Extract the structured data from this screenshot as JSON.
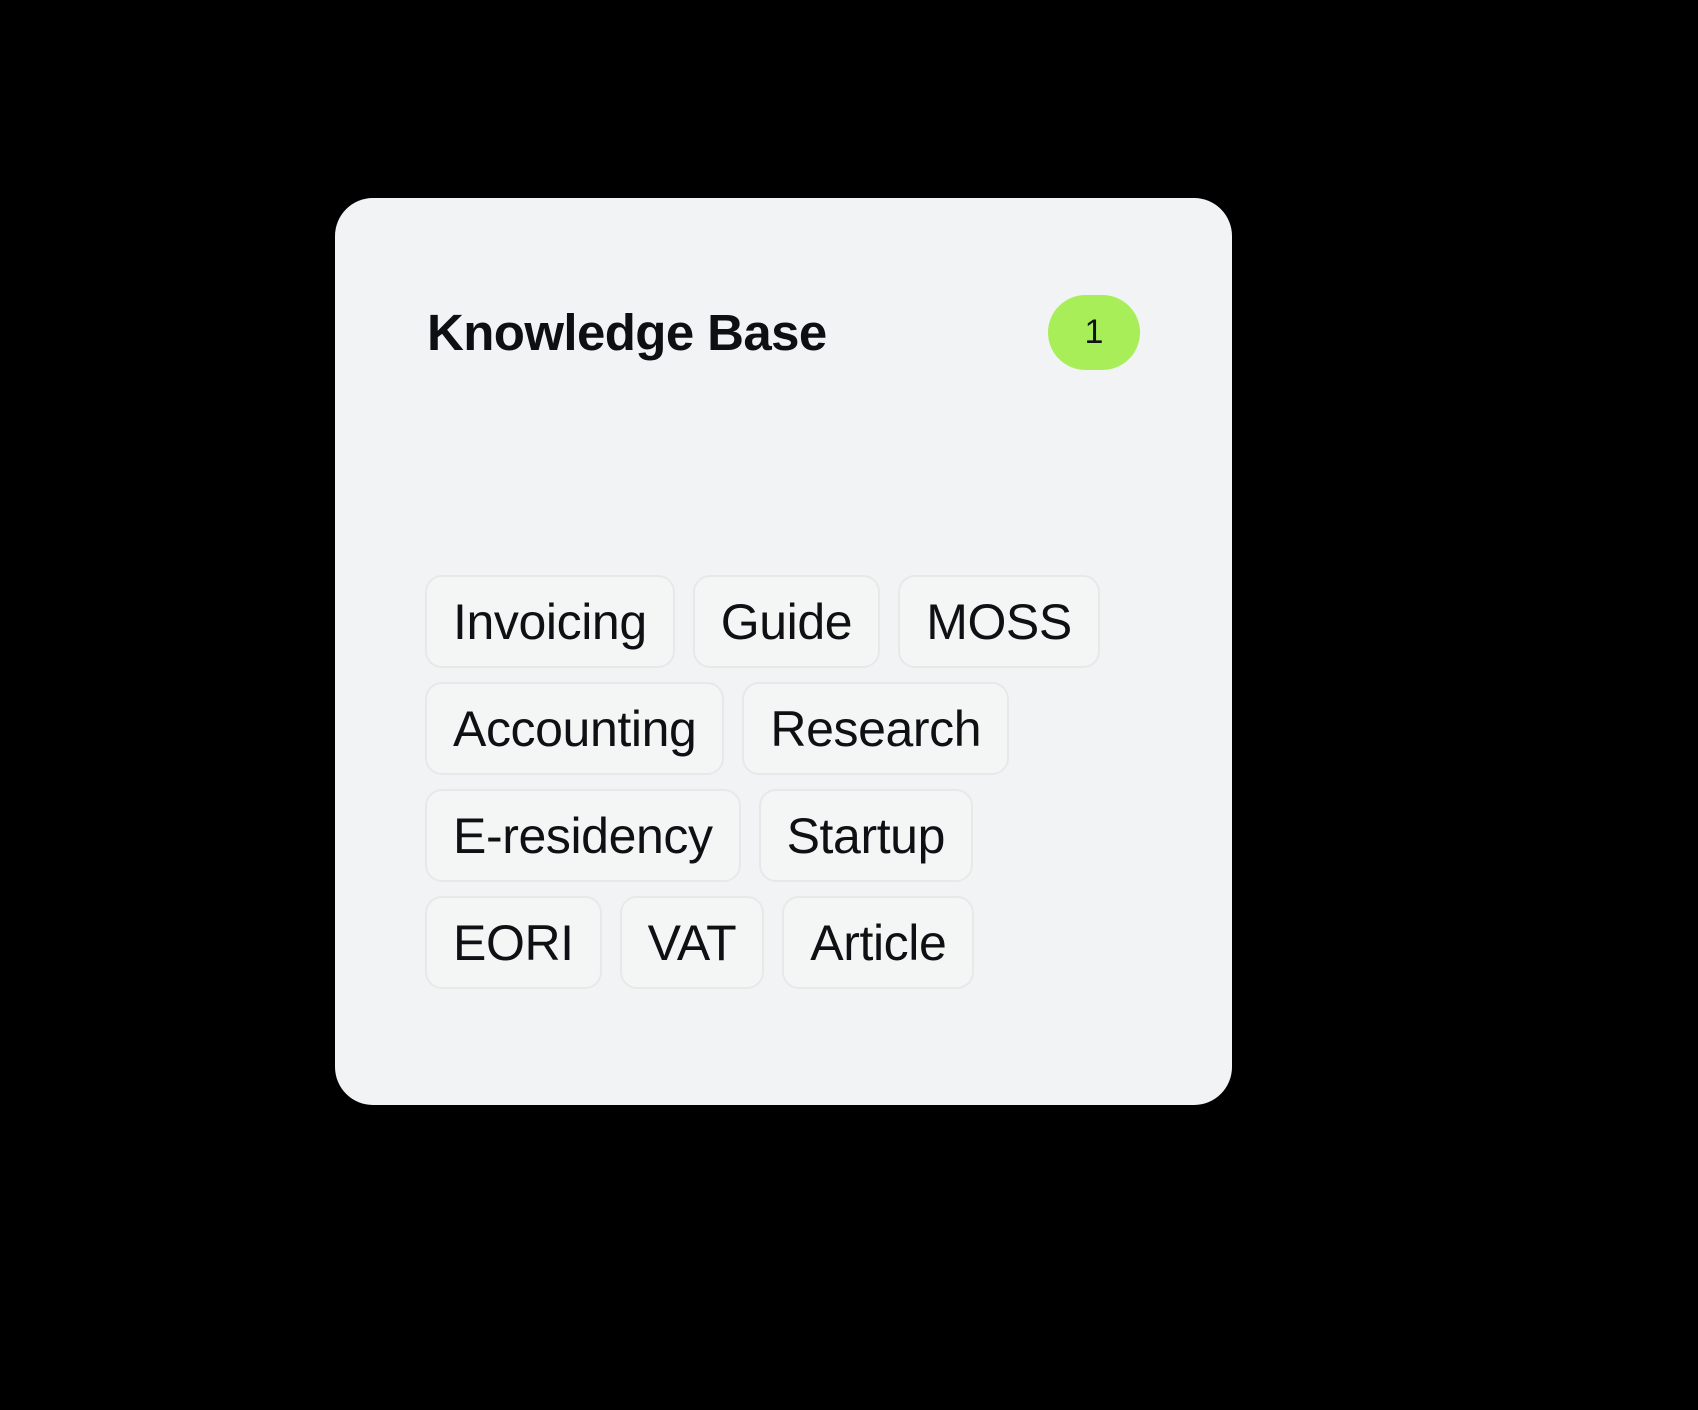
{
  "card": {
    "background_color": "#F1F3F5",
    "page_background_color": "#000000"
  },
  "header": {
    "title": "Knowledge Base",
    "badge": {
      "count": "1",
      "color": "#A8EE58",
      "text_color": "#111418"
    }
  },
  "tags": [
    {
      "label": "Invoicing"
    },
    {
      "label": "Guide"
    },
    {
      "label": "MOSS"
    },
    {
      "label": "Accounting"
    },
    {
      "label": "Research"
    },
    {
      "label": "E-residency"
    },
    {
      "label": "Startup"
    },
    {
      "label": "EORI"
    },
    {
      "label": "VAT"
    },
    {
      "label": "Article"
    }
  ]
}
